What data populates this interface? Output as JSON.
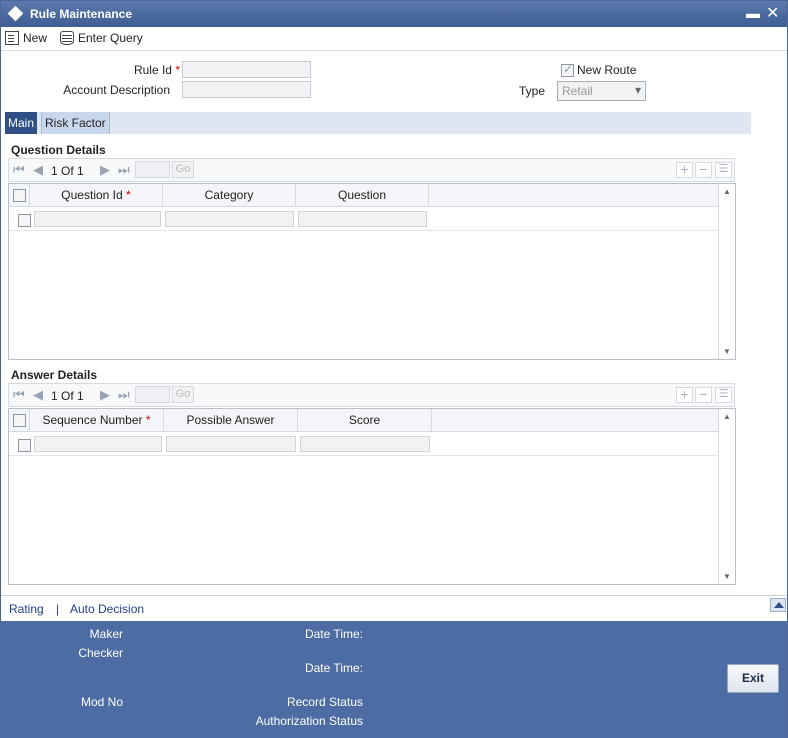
{
  "window": {
    "title": "Rule Maintenance",
    "minimize_icon": "minimize-icon",
    "close_icon": "close-icon"
  },
  "toolbar": {
    "new_label": "New",
    "enter_query_label": "Enter Query"
  },
  "form": {
    "rule_id_label": "Rule Id",
    "rule_id_value": "",
    "account_description_label": "Account Description",
    "account_description_value": "",
    "new_route_label": "New Route",
    "new_route_checked": true,
    "type_label": "Type",
    "type_value": "Retail",
    "required_mark": "*"
  },
  "tabs": [
    {
      "label": "Main",
      "active": true
    },
    {
      "label": "Risk Factor",
      "active": false
    }
  ],
  "question_details": {
    "title": "Question Details",
    "page_current": "1",
    "page_of": "Of",
    "page_total": "1",
    "go_label": "Go",
    "columns": [
      "Question Id",
      "Category",
      "Question"
    ]
  },
  "answer_details": {
    "title": "Answer Details",
    "page_current": "1",
    "page_of": "Of",
    "page_total": "1",
    "go_label": "Go",
    "columns": [
      "Sequence Number",
      "Possible Answer",
      "Score"
    ]
  },
  "links": {
    "rating": "Rating",
    "separator": "|",
    "auto_decision": "Auto Decision"
  },
  "footer": {
    "maker_label": "Maker",
    "checker_label": "Checker",
    "date_time_label_1": "Date Time:",
    "date_time_label_2": "Date Time:",
    "mod_no_label": "Mod No",
    "record_status_label": "Record Status",
    "authorization_status_label": "Authorization Status",
    "exit_label": "Exit"
  },
  "colors": {
    "title_bar": "#3e5d92",
    "footer": "#4d6ca3",
    "active_tab": "#2f4f86",
    "link": "#1f3f8a",
    "required": "#cc0000"
  }
}
